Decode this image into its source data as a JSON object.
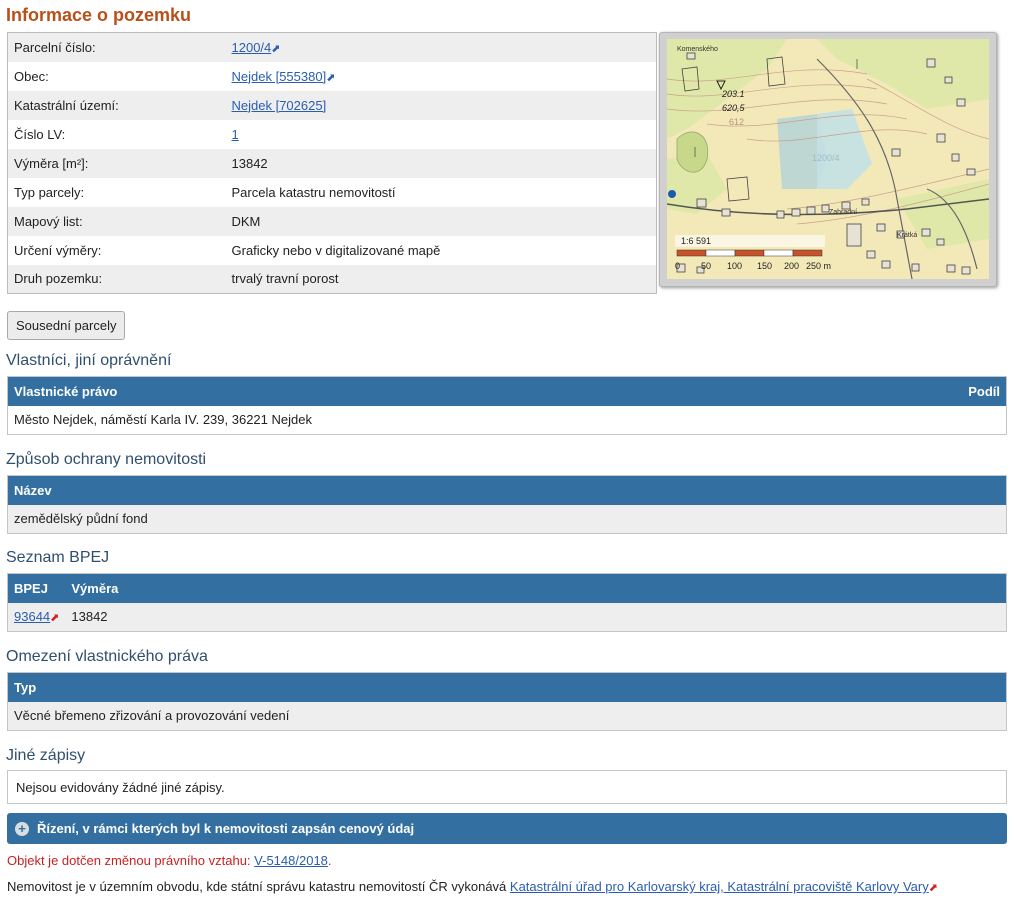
{
  "page_title": "Informace o pozemku",
  "parcel_info": [
    {
      "label": "Parcelní číslo:",
      "value": "1200/4",
      "link": true,
      "ext": true
    },
    {
      "label": "Obec:",
      "value": "Nejdek [555380]",
      "link": true,
      "ext": true
    },
    {
      "label": "Katastrální území:",
      "value": "Nejdek [702625]",
      "link": true,
      "ext": false
    },
    {
      "label": "Číslo LV:",
      "value": "1",
      "link": true,
      "ext": false
    },
    {
      "label": "Výměra [m²]:",
      "value": "13842",
      "link": false,
      "ext": false
    },
    {
      "label": "Typ parcely:",
      "value": "Parcela katastru nemovitostí",
      "link": false,
      "ext": false
    },
    {
      "label": "Mapový list:",
      "value": "DKM",
      "link": false,
      "ext": false
    },
    {
      "label": "Určení výměry:",
      "value": "Graficky nebo v digitalizované mapě",
      "link": false,
      "ext": false
    },
    {
      "label": "Druh pozemku:",
      "value": "trvalý travní porost",
      "link": false,
      "ext": false
    }
  ],
  "map": {
    "labels": {
      "street1": "Komenského",
      "street2": "Zahradní",
      "street3": "Krátká",
      "elev1": "203.1",
      "elev2": "620,5",
      "contour": "612",
      "parcel": "1200/4"
    },
    "scale_text": "1:6 591",
    "scale_ticks": [
      "0",
      "50",
      "100",
      "150",
      "200",
      "250 m"
    ]
  },
  "buttons": {
    "neighbors": "Sousední parcely"
  },
  "owners": {
    "heading": "Vlastníci, jiní oprávnění",
    "col1": "Vlastnické právo",
    "col2": "Podíl",
    "row": "Město Nejdek, náměstí Karla IV. 239, 36221 Nejdek"
  },
  "protection": {
    "heading": "Způsob ochrany nemovitosti",
    "col1": "Název",
    "row": "zemědělský půdní fond"
  },
  "bpej": {
    "heading": "Seznam BPEJ",
    "col1": "BPEJ",
    "col2": "Výměra",
    "code": "93644",
    "area": "13842"
  },
  "restriction": {
    "heading": "Omezení vlastnického práva",
    "col1": "Typ",
    "row": "Věcné břemeno zřizování a provozování vedení"
  },
  "other": {
    "heading": "Jiné zápisy",
    "text": "Nejsou evidovány žádné jiné zápisy."
  },
  "proceedings": {
    "label": "Řízení, v rámci kterých byl k nemovitosti zapsán cenový údaj"
  },
  "notes": {
    "change_prefix": "Objekt je dotčen změnou právního vztahu:",
    "change_link": "V-5148/2018",
    "change_suffix": ".",
    "office_prefix": "Nemovitost je v územním obvodu, kde státní správu katastru nemovitostí ČR vykonává",
    "office_link": "Katastrální úřad pro Karlovarský kraj, Katastrální pracoviště Karlovy Vary"
  },
  "colors": {
    "title": "#b8501a",
    "header_bar": "#336fa0",
    "link": "#2a5db0",
    "notice": "#cc1f1f"
  }
}
